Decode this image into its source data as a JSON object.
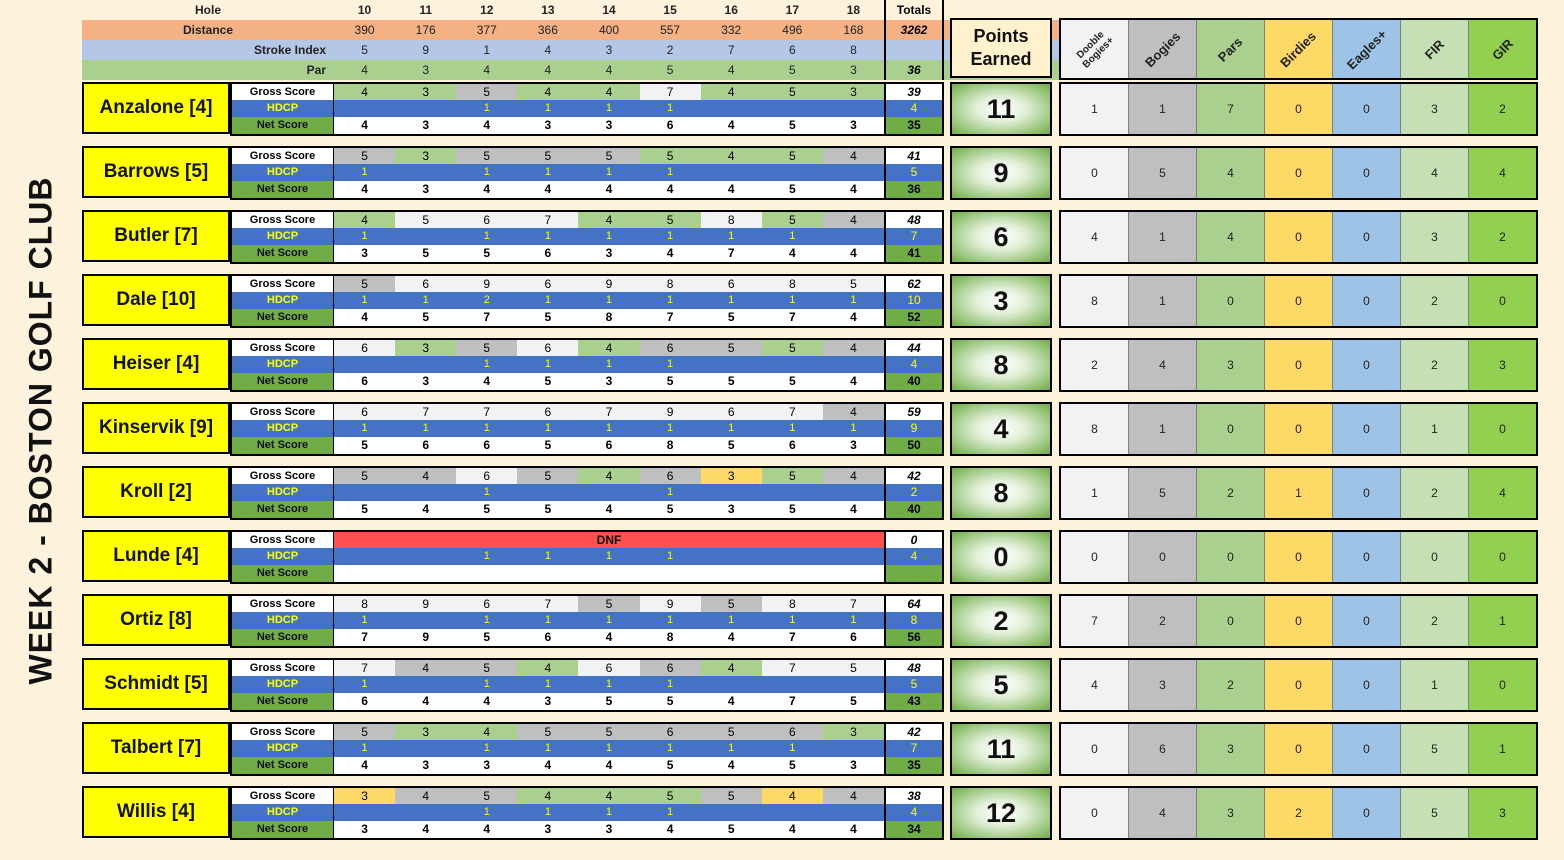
{
  "title": "WEEK 2 - BOSTON GOLF CLUB",
  "labels": {
    "hole": "Hole",
    "distance": "Distance",
    "stroke_index": "Stroke Index",
    "par": "Par",
    "totals": "Totals",
    "gross": "Gross Score",
    "hdcp": "HDCP",
    "net": "Net Score",
    "points_earned_line1": "Points",
    "points_earned_line2": "Earned"
  },
  "stat_headers": [
    "Dooble\nBogies+",
    "Bogies",
    "Pars",
    "Birdies",
    "Eagles+",
    "FIR",
    "GIR"
  ],
  "holes": [
    "10",
    "11",
    "12",
    "13",
    "14",
    "15",
    "16",
    "17",
    "18"
  ],
  "distance": [
    "390",
    "176",
    "377",
    "366",
    "400",
    "557",
    "332",
    "496",
    "168"
  ],
  "distance_total": "3262",
  "stroke_index": [
    "5",
    "9",
    "1",
    "4",
    "3",
    "2",
    "7",
    "6",
    "8"
  ],
  "par": [
    "4",
    "3",
    "4",
    "4",
    "4",
    "5",
    "4",
    "5",
    "3"
  ],
  "par_total": "36",
  "colors": {
    "birdie": "#ffd966",
    "par": "#a9d08e",
    "bogey": "#bfbfbf",
    "double": "#f2f2f2",
    "dnf": "#ff5050",
    "hdcp_bg": "#4472c4",
    "name_bg": "#ffff00",
    "stat_cols": [
      "#f2f2f2",
      "#bfbfbf",
      "#a9d08e",
      "#ffd966",
      "#9dc3e6",
      "#c5e0b4",
      "#92d050"
    ]
  },
  "players": [
    {
      "name": "Anzalone [4]",
      "gross": [
        "4",
        "3",
        "5",
        "4",
        "4",
        "7",
        "4",
        "5",
        "3"
      ],
      "gross_total": "39",
      "hdcp": [
        "",
        "",
        "1",
        "1",
        "1",
        "1",
        "",
        "",
        ""
      ],
      "hdcp_total": "4",
      "net": [
        "4",
        "3",
        "4",
        "3",
        "3",
        "6",
        "4",
        "5",
        "3"
      ],
      "net_total": "35",
      "points": "11",
      "stats": [
        "1",
        "1",
        "7",
        "0",
        "0",
        "3",
        "2"
      ]
    },
    {
      "name": "Barrows [5]",
      "gross": [
        "5",
        "3",
        "5",
        "5",
        "5",
        "5",
        "4",
        "5",
        "4"
      ],
      "gross_total": "41",
      "hdcp": [
        "1",
        "",
        "1",
        "1",
        "1",
        "1",
        "",
        "",
        ""
      ],
      "hdcp_total": "5",
      "net": [
        "4",
        "3",
        "4",
        "4",
        "4",
        "4",
        "4",
        "5",
        "4"
      ],
      "net_total": "36",
      "points": "9",
      "stats": [
        "0",
        "5",
        "4",
        "0",
        "0",
        "4",
        "4"
      ]
    },
    {
      "name": "Butler [7]",
      "gross": [
        "4",
        "5",
        "6",
        "7",
        "4",
        "5",
        "8",
        "5",
        "4"
      ],
      "gross_total": "48",
      "hdcp": [
        "1",
        "",
        "1",
        "1",
        "1",
        "1",
        "1",
        "1",
        ""
      ],
      "hdcp_total": "7",
      "net": [
        "3",
        "5",
        "5",
        "6",
        "3",
        "4",
        "7",
        "4",
        "4"
      ],
      "net_total": "41",
      "points": "6",
      "stats": [
        "4",
        "1",
        "4",
        "0",
        "0",
        "3",
        "2"
      ]
    },
    {
      "name": "Dale [10]",
      "gross": [
        "5",
        "6",
        "9",
        "6",
        "9",
        "8",
        "6",
        "8",
        "5"
      ],
      "gross_total": "62",
      "hdcp": [
        "1",
        "1",
        "2",
        "1",
        "1",
        "1",
        "1",
        "1",
        "1"
      ],
      "hdcp_total": "10",
      "net": [
        "4",
        "5",
        "7",
        "5",
        "8",
        "7",
        "5",
        "7",
        "4"
      ],
      "net_total": "52",
      "points": "3",
      "stats": [
        "8",
        "1",
        "0",
        "0",
        "0",
        "2",
        "0"
      ]
    },
    {
      "name": "Heiser [4]",
      "gross": [
        "6",
        "3",
        "5",
        "6",
        "4",
        "6",
        "5",
        "5",
        "4"
      ],
      "gross_total": "44",
      "hdcp": [
        "",
        "",
        "1",
        "1",
        "1",
        "1",
        "",
        "",
        ""
      ],
      "hdcp_total": "4",
      "net": [
        "6",
        "3",
        "4",
        "5",
        "3",
        "5",
        "5",
        "5",
        "4"
      ],
      "net_total": "40",
      "points": "8",
      "stats": [
        "2",
        "4",
        "3",
        "0",
        "0",
        "2",
        "3"
      ]
    },
    {
      "name": "Kinservik [9]",
      "gross": [
        "6",
        "7",
        "7",
        "6",
        "7",
        "9",
        "6",
        "7",
        "4"
      ],
      "gross_total": "59",
      "hdcp": [
        "1",
        "1",
        "1",
        "1",
        "1",
        "1",
        "1",
        "1",
        "1"
      ],
      "hdcp_total": "9",
      "net": [
        "5",
        "6",
        "6",
        "5",
        "6",
        "8",
        "5",
        "6",
        "3"
      ],
      "net_total": "50",
      "points": "4",
      "stats": [
        "8",
        "1",
        "0",
        "0",
        "0",
        "1",
        "0"
      ]
    },
    {
      "name": "Kroll [2]",
      "gross": [
        "5",
        "4",
        "6",
        "5",
        "4",
        "6",
        "3",
        "5",
        "4"
      ],
      "gross_total": "42",
      "hdcp": [
        "",
        "",
        "1",
        "",
        "",
        "1",
        "",
        "",
        ""
      ],
      "hdcp_total": "2",
      "net": [
        "5",
        "4",
        "5",
        "5",
        "4",
        "5",
        "3",
        "5",
        "4"
      ],
      "net_total": "40",
      "points": "8",
      "stats": [
        "1",
        "5",
        "2",
        "1",
        "0",
        "2",
        "4"
      ]
    },
    {
      "name": "Lunde [4]",
      "dnf": "DNF",
      "gross": [
        "",
        "",
        "",
        "",
        "",
        "",
        "",
        "",
        ""
      ],
      "gross_total": "0",
      "hdcp": [
        "",
        "",
        "1",
        "1",
        "1",
        "1",
        "",
        "",
        ""
      ],
      "hdcp_total": "4",
      "net": [
        "",
        "",
        "",
        "",
        "",
        "",
        "",
        "",
        ""
      ],
      "net_total": "",
      "points": "0",
      "stats": [
        "0",
        "0",
        "0",
        "0",
        "0",
        "0",
        "0"
      ]
    },
    {
      "name": "Ortiz [8]",
      "gross": [
        "8",
        "9",
        "6",
        "7",
        "5",
        "9",
        "5",
        "8",
        "7"
      ],
      "gross_total": "64",
      "hdcp": [
        "1",
        "",
        "1",
        "1",
        "1",
        "1",
        "1",
        "1",
        "1"
      ],
      "hdcp_total": "8",
      "net": [
        "7",
        "9",
        "5",
        "6",
        "4",
        "8",
        "4",
        "7",
        "6"
      ],
      "net_total": "56",
      "points": "2",
      "stats": [
        "7",
        "2",
        "0",
        "0",
        "0",
        "2",
        "1"
      ]
    },
    {
      "name": "Schmidt [5]",
      "gross": [
        "7",
        "4",
        "5",
        "4",
        "6",
        "6",
        "4",
        "7",
        "5"
      ],
      "gross_total": "48",
      "hdcp": [
        "1",
        "",
        "1",
        "1",
        "1",
        "1",
        "",
        "",
        ""
      ],
      "hdcp_total": "5",
      "net": [
        "6",
        "4",
        "4",
        "3",
        "5",
        "5",
        "4",
        "7",
        "5"
      ],
      "net_total": "43",
      "points": "5",
      "stats": [
        "4",
        "3",
        "2",
        "0",
        "0",
        "1",
        "0"
      ]
    },
    {
      "name": "Talbert [7]",
      "gross": [
        "5",
        "3",
        "4",
        "5",
        "5",
        "6",
        "5",
        "6",
        "3"
      ],
      "gross_total": "42",
      "hdcp": [
        "1",
        "",
        "1",
        "1",
        "1",
        "1",
        "1",
        "1",
        ""
      ],
      "hdcp_total": "7",
      "net": [
        "4",
        "3",
        "3",
        "4",
        "4",
        "5",
        "4",
        "5",
        "3"
      ],
      "net_total": "35",
      "points": "11",
      "stats": [
        "0",
        "6",
        "3",
        "0",
        "0",
        "5",
        "1"
      ]
    },
    {
      "name": "Willis [4]",
      "gross": [
        "3",
        "4",
        "5",
        "4",
        "4",
        "5",
        "5",
        "4",
        "4"
      ],
      "gross_total": "38",
      "hdcp": [
        "",
        "",
        "1",
        "1",
        "1",
        "1",
        "",
        "",
        ""
      ],
      "hdcp_total": "4",
      "net": [
        "3",
        "4",
        "4",
        "3",
        "3",
        "4",
        "5",
        "4",
        "4"
      ],
      "net_total": "34",
      "points": "12",
      "stats": [
        "0",
        "4",
        "3",
        "2",
        "0",
        "5",
        "3"
      ]
    }
  ]
}
